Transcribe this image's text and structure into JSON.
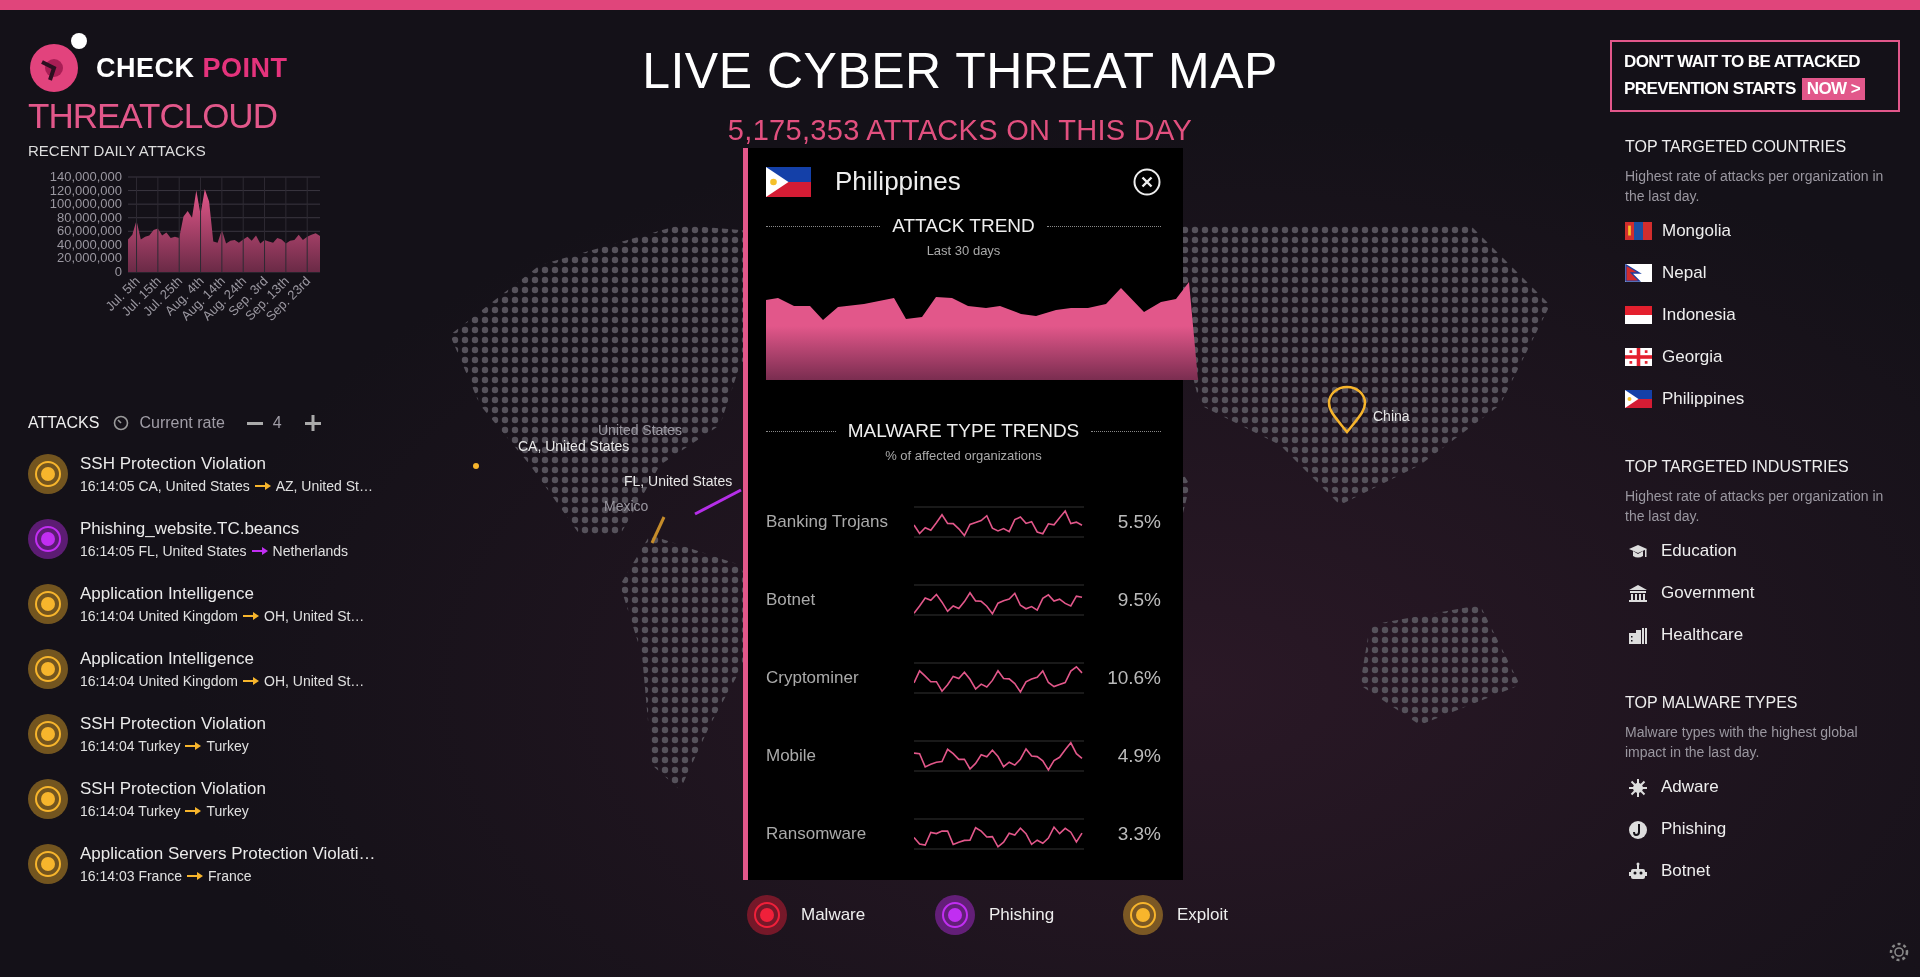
{
  "brand": {
    "words": [
      "CHECK",
      "POINT"
    ],
    "product": "THREATCLOUD"
  },
  "daily_attacks": {
    "title": "RECENT DAILY ATTACKS",
    "chart_data": {
      "type": "area",
      "categories": [
        null,
        null,
        "Jul. 5th",
        null,
        null,
        null,
        null,
        "Jul. 15th",
        null,
        null,
        null,
        null,
        "Jul. 25th",
        null,
        null,
        null,
        null,
        "Aug. 4th",
        null,
        null,
        null,
        null,
        "Aug. 14th",
        null,
        null,
        null,
        null,
        "Aug. 24th",
        null,
        null,
        null,
        null,
        "Sep. 3rd",
        null,
        null,
        null,
        null,
        "Sep. 13th",
        null,
        null,
        null,
        null,
        "Sep. 23rd",
        null,
        null,
        null
      ],
      "values": [
        48000000,
        55000000,
        76000000,
        48000000,
        52000000,
        54000000,
        62000000,
        64000000,
        54000000,
        58000000,
        50000000,
        52000000,
        50000000,
        82000000,
        90000000,
        80000000,
        120000000,
        85000000,
        122000000,
        104000000,
        45000000,
        43000000,
        62000000,
        42000000,
        46000000,
        47000000,
        43000000,
        48000000,
        52000000,
        46000000,
        54000000,
        42000000,
        47000000,
        45000000,
        43000000,
        50000000,
        48000000,
        42000000,
        46000000,
        47000000,
        55000000,
        47000000,
        52000000,
        55000000,
        57000000,
        53000000
      ],
      "ylim": [
        0,
        140000000
      ],
      "grid": true,
      "yticks": [
        {
          "value": 0,
          "label": "0"
        },
        {
          "value": 20000000,
          "label": "20,000,000"
        },
        {
          "value": 40000000,
          "label": "40,000,000"
        },
        {
          "value": 60000000,
          "label": "60,000,000"
        },
        {
          "value": 80000000,
          "label": "80,000,000"
        },
        {
          "value": 100000000,
          "label": "100,000,000"
        },
        {
          "value": 120000000,
          "label": "120,000,000"
        },
        {
          "value": 140000000,
          "label": "140,000,000"
        }
      ]
    }
  },
  "attacks": {
    "title": "ATTACKS",
    "rate_label": "Current rate",
    "rate_value": "4",
    "items": [
      {
        "title": "SSH Protection Violation",
        "from": "16:14:05 CA, United States",
        "to": "AZ, United St…",
        "color": "#f7b52c"
      },
      {
        "title": "Phishing_website.TC.beancs",
        "from": "16:14:05 FL, United States",
        "to": "Netherlands",
        "color": "#c12ef2"
      },
      {
        "title": "Application Intelligence",
        "from": "16:14:04 United Kingdom",
        "to": "OH, United St…",
        "color": "#f7b52c"
      },
      {
        "title": "Application Intelligence",
        "from": "16:14:04 United Kingdom",
        "to": "OH, United St…",
        "color": "#f7b52c"
      },
      {
        "title": "SSH Protection Violation",
        "from": "16:14:04 Turkey",
        "to": "Turkey",
        "color": "#f7b52c"
      },
      {
        "title": "SSH Protection Violation",
        "from": "16:14:04 Turkey",
        "to": "Turkey",
        "color": "#f7b52c"
      },
      {
        "title": "Application Servers Protection Violati…",
        "from": "16:14:03 France",
        "to": "France",
        "color": "#f7b52c"
      }
    ]
  },
  "header": {
    "title": "LIVE CYBER THREAT MAP",
    "count": "5,175,353 ATTACKS ON THIS DAY"
  },
  "map_labels": [
    {
      "text": "United States",
      "dim": true
    },
    {
      "text": "CA, United States",
      "dim": false
    },
    {
      "text": "FL, United States",
      "dim": false
    },
    {
      "text": "Mexico",
      "dim": true
    },
    {
      "text": "China",
      "dim": false
    }
  ],
  "country_popup": {
    "country": "Philippines",
    "trend_title": "ATTACK TREND",
    "trend_subtitle": "Last 30 days",
    "malware_title": "MALWARE TYPE TRENDS",
    "malware_subtitle": "% of affected organizations",
    "malware": [
      {
        "name": "Banking Trojans",
        "value": "5.5%"
      },
      {
        "name": "Botnet",
        "value": "9.5%"
      },
      {
        "name": "Cryptominer",
        "value": "10.6%"
      },
      {
        "name": "Mobile",
        "value": "4.9%"
      },
      {
        "name": "Ransomware",
        "value": "3.3%"
      }
    ]
  },
  "legend": [
    {
      "label": "Malware",
      "color": "#f0203a"
    },
    {
      "label": "Phishing",
      "color": "#c12ef2"
    },
    {
      "label": "Exploit",
      "color": "#f7b52c"
    }
  ],
  "banner": {
    "line1": "DON'T WAIT TO BE ATTACKED",
    "line2": "PREVENTION STARTS",
    "cta": "NOW >"
  },
  "sections": [
    {
      "kind": "countries",
      "title": "TOP TARGETED COUNTRIES",
      "description": "Highest rate of attacks per organization in the last day.",
      "items": [
        {
          "label": "Mongolia"
        },
        {
          "label": "Nepal"
        },
        {
          "label": "Indonesia"
        },
        {
          "label": "Georgia"
        },
        {
          "label": "Philippines"
        }
      ]
    },
    {
      "kind": "industries",
      "title": "TOP TARGETED INDUSTRIES",
      "description": "Highest rate of attacks per organization in the last day.",
      "items": [
        {
          "label": "Education"
        },
        {
          "label": "Government"
        },
        {
          "label": "Healthcare"
        }
      ]
    },
    {
      "kind": "malware",
      "title": "TOP MALWARE TYPES",
      "description": "Malware types with the highest global impact in the last day.",
      "items": [
        {
          "label": "Adware"
        },
        {
          "label": "Phishing"
        },
        {
          "label": "Botnet"
        }
      ]
    }
  ]
}
